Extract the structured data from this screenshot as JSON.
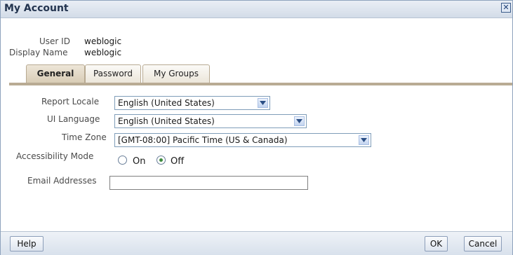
{
  "dialog": {
    "title": "My Account",
    "close_icon": "close-icon"
  },
  "user": {
    "user_id_label": "User ID",
    "user_id": "weblogic",
    "display_name_label": "Display Name",
    "display_name": "weblogic"
  },
  "tabs": [
    {
      "label": "General",
      "active": true
    },
    {
      "label": "Password",
      "active": false
    },
    {
      "label": "My Groups",
      "active": false
    }
  ],
  "form": {
    "report_locale_label": "Report Locale",
    "report_locale": "English (United States)",
    "ui_language_label": "UI Language",
    "ui_language": "English (United States)",
    "time_zone_label": "Time Zone",
    "time_zone": "[GMT-08:00] Pacific Time (US & Canada)",
    "accessibility_label": "Accessibility Mode",
    "on_label": "On",
    "off_label": "Off",
    "accessibility_value": "Off",
    "email_label": "Email Addresses",
    "email_value": ""
  },
  "footer": {
    "help": "Help",
    "ok": "OK",
    "cancel": "Cancel"
  },
  "colors": {
    "title_bar": "#dce4ee",
    "tab_active": "#d9cdb6",
    "tab_line": "#b9ab94"
  }
}
